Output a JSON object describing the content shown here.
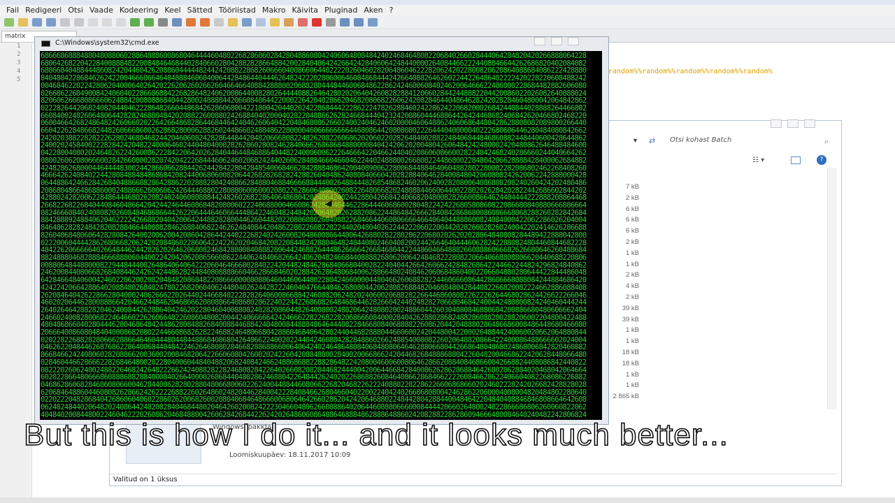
{
  "menu": [
    "Fail",
    "Redigeeri",
    "Otsi",
    "Vaade",
    "Kodeering",
    "Keel",
    "Sätted",
    "Tööriistad",
    "Makro",
    "Käivita",
    "Pluginad",
    "Aken",
    "?"
  ],
  "tab_label": "matrix",
  "line_numbers": [
    "1",
    "2",
    "3",
    "4",
    "5"
  ],
  "code_text": "random%%random%%random%%random%%random%",
  "cmd": {
    "title": "C:\\Windows\\system32\\cmd.exe"
  },
  "explorer": {
    "search_placeholder": "Otsi kohast Batch",
    "sizes": [
      "7 kB",
      "2 kB",
      "6 kB",
      "6 kB",
      "6 kB",
      "2 kB",
      "1 kB",
      "1 kB",
      "2 kB",
      "4 kB",
      "2 kB",
      "39 kB",
      "39 kB",
      "1 kB",
      "1 kB",
      "18 kB",
      "18 kB",
      "1 kB",
      "1 kB",
      "2 865 kB"
    ],
    "status": "Valitud on 1 üksus",
    "detail_type": "Windowsi pakkfail",
    "detail_date_label": "Loomiskuupäev: 18.11.2017 10:09"
  },
  "subtitle": "But this is how I do it... and it looks much better...",
  "colors": {
    "matrix_green": "#23d92e",
    "console_bg": "#000000",
    "code_orange": "#e0a000"
  }
}
